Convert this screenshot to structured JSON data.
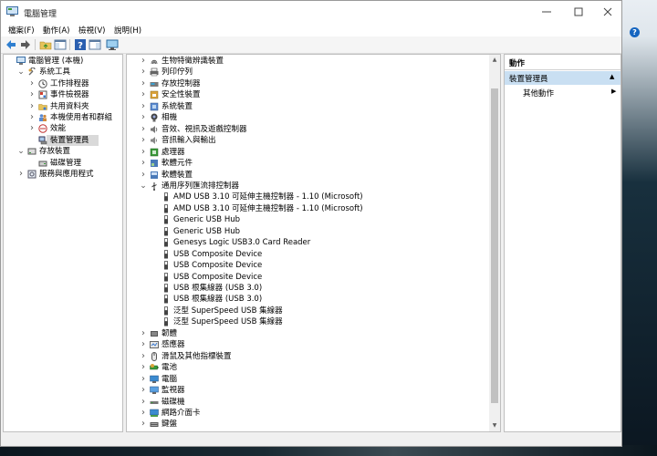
{
  "window": {
    "title": "電腦管理",
    "controls": [
      "minimize",
      "maximize",
      "close"
    ]
  },
  "menu": [
    {
      "label": "檔案(F)"
    },
    {
      "label": "動作(A)"
    },
    {
      "label": "檢視(V)"
    },
    {
      "label": "說明(H)"
    }
  ],
  "toolbar": {
    "buttons": [
      "back-arrow-icon",
      "forward-arrow-icon",
      "up-folder-icon",
      "show-hide-tree-icon",
      "help-icon",
      "action-pane-icon",
      "monitor-icon"
    ]
  },
  "tree": [
    {
      "label": "電腦管理 (本機)",
      "level": 0,
      "arrow": "",
      "icon": "computer-management-icon"
    },
    {
      "label": "系統工具",
      "level": 1,
      "arrow": "expanded",
      "icon": "tools-icon"
    },
    {
      "label": "工作排程器",
      "level": 2,
      "arrow": "collapsed",
      "icon": "clock-icon"
    },
    {
      "label": "事件檢視器",
      "level": 2,
      "arrow": "collapsed",
      "icon": "event-viewer-icon"
    },
    {
      "label": "共用資料夾",
      "level": 2,
      "arrow": "collapsed",
      "icon": "shared-folder-icon"
    },
    {
      "label": "本機使用者和群組",
      "level": 2,
      "arrow": "collapsed",
      "icon": "users-icon"
    },
    {
      "label": "效能",
      "level": 2,
      "arrow": "collapsed",
      "icon": "performance-icon"
    },
    {
      "label": "裝置管理員",
      "level": 2,
      "arrow": "",
      "icon": "device-manager-icon",
      "selected": true
    },
    {
      "label": "存放裝置",
      "level": 1,
      "arrow": "expanded",
      "icon": "storage-icon"
    },
    {
      "label": "磁碟管理",
      "level": 2,
      "arrow": "",
      "icon": "disk-management-icon"
    },
    {
      "label": "服務與應用程式",
      "level": 1,
      "arrow": "collapsed",
      "icon": "services-icon"
    }
  ],
  "devices": [
    {
      "label": "生物特徵辨識裝置",
      "level": 0,
      "arrow": "collapsed",
      "icon": "fingerprint-icon"
    },
    {
      "label": "列印佇列",
      "level": 0,
      "arrow": "collapsed",
      "icon": "printer-icon"
    },
    {
      "label": "存放控制器",
      "level": 0,
      "arrow": "collapsed",
      "icon": "storage-controller-icon"
    },
    {
      "label": "安全性裝置",
      "level": 0,
      "arrow": "collapsed",
      "icon": "security-device-icon"
    },
    {
      "label": "系統裝置",
      "level": 0,
      "arrow": "collapsed",
      "icon": "system-device-icon"
    },
    {
      "label": "相機",
      "level": 0,
      "arrow": "collapsed",
      "icon": "camera-icon"
    },
    {
      "label": "音效、視訊及遊戲控制器",
      "level": 0,
      "arrow": "collapsed",
      "icon": "speaker-icon"
    },
    {
      "label": "音訊輸入與輸出",
      "level": 0,
      "arrow": "collapsed",
      "icon": "audio-io-icon"
    },
    {
      "label": "處理器",
      "level": 0,
      "arrow": "collapsed",
      "icon": "processor-icon"
    },
    {
      "label": "軟體元件",
      "level": 0,
      "arrow": "collapsed",
      "icon": "software-component-icon"
    },
    {
      "label": "軟體裝置",
      "level": 0,
      "arrow": "collapsed",
      "icon": "software-device-icon"
    },
    {
      "label": "通用序列匯流排控制器",
      "level": 0,
      "arrow": "expanded",
      "icon": "usb-icon"
    },
    {
      "label": "AMD USB 3.10 可延伸主機控制器 - 1.10 (Microsoft)",
      "level": 1,
      "arrow": "",
      "icon": "usb-device-icon"
    },
    {
      "label": "AMD USB 3.10 可延伸主機控制器 - 1.10 (Microsoft)",
      "level": 1,
      "arrow": "",
      "icon": "usb-device-icon"
    },
    {
      "label": "Generic USB Hub",
      "level": 1,
      "arrow": "",
      "icon": "usb-device-icon"
    },
    {
      "label": "Generic USB Hub",
      "level": 1,
      "arrow": "",
      "icon": "usb-device-icon"
    },
    {
      "label": "Genesys Logic USB3.0 Card Reader",
      "level": 1,
      "arrow": "",
      "icon": "usb-device-icon"
    },
    {
      "label": "USB Composite Device",
      "level": 1,
      "arrow": "",
      "icon": "usb-device-icon"
    },
    {
      "label": "USB Composite Device",
      "level": 1,
      "arrow": "",
      "icon": "usb-device-icon"
    },
    {
      "label": "USB Composite Device",
      "level": 1,
      "arrow": "",
      "icon": "usb-device-icon"
    },
    {
      "label": "USB 根集線器 (USB 3.0)",
      "level": 1,
      "arrow": "",
      "icon": "usb-device-icon"
    },
    {
      "label": "USB 根集線器 (USB 3.0)",
      "level": 1,
      "arrow": "",
      "icon": "usb-device-icon"
    },
    {
      "label": "泛型 SuperSpeed USB 集線器",
      "level": 1,
      "arrow": "",
      "icon": "usb-device-icon"
    },
    {
      "label": "泛型 SuperSpeed USB 集線器",
      "level": 1,
      "arrow": "",
      "icon": "usb-device-icon"
    },
    {
      "label": "韌體",
      "level": 0,
      "arrow": "collapsed",
      "icon": "firmware-icon"
    },
    {
      "label": "感應器",
      "level": 0,
      "arrow": "collapsed",
      "icon": "sensor-icon"
    },
    {
      "label": "滑鼠及其他指標裝置",
      "level": 0,
      "arrow": "collapsed",
      "icon": "mouse-icon"
    },
    {
      "label": "電池",
      "level": 0,
      "arrow": "collapsed",
      "icon": "battery-icon"
    },
    {
      "label": "電腦",
      "level": 0,
      "arrow": "collapsed",
      "icon": "computer-icon"
    },
    {
      "label": "監視器",
      "level": 0,
      "arrow": "collapsed",
      "icon": "monitor-icon"
    },
    {
      "label": "磁碟機",
      "level": 0,
      "arrow": "collapsed",
      "icon": "disk-drive-icon"
    },
    {
      "label": "網路介面卡",
      "level": 0,
      "arrow": "collapsed",
      "icon": "network-adapter-icon"
    },
    {
      "label": "鍵盤",
      "level": 0,
      "arrow": "collapsed",
      "icon": "keyboard-icon"
    }
  ],
  "actions": {
    "header": "動作",
    "section": "裝置管理員",
    "items": [
      {
        "label": "其他動作"
      }
    ]
  },
  "colors": {
    "selection": "#c9dff2",
    "accent": "#1565c0"
  }
}
